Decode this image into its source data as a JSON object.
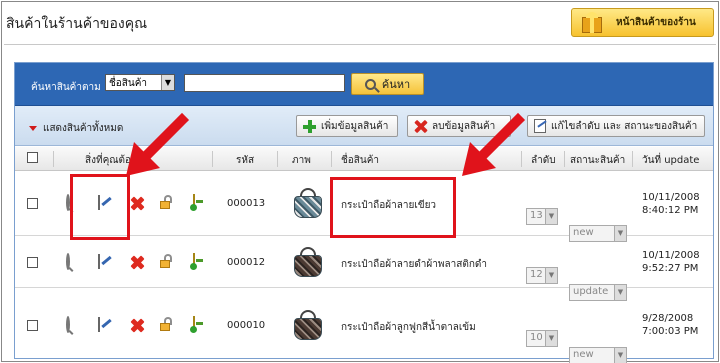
{
  "page": {
    "title": "สินค้าในร้านค้าของคุณ",
    "store_button_label": "หน้าสินค้าของร้าน"
  },
  "search": {
    "label": "ค้นหาสินค้าตาม :",
    "field_option": "ชื่อสินค้า",
    "query_value": "",
    "button_label": "ค้นหา"
  },
  "actions": {
    "show_all_label": "แสดงสินค้าทั้งหมด",
    "add_label": "เพิ่มข้อมูลสินค้า",
    "delete_label": "ลบข้อมูลสินค้า",
    "edit_order_label": "แก้ไขลำดับ และ สถานะของสินค้า"
  },
  "table": {
    "headers": {
      "actions": "สิ่งที่คุณต้องทำ",
      "code": "รหัส",
      "image": "ภาพ",
      "name": "ชื่อสินค้า",
      "order": "ลำดับ",
      "status": "สถานะสินค้า",
      "updated": "วันที่ update"
    },
    "rows": [
      {
        "code": "000013",
        "name": "กระเป๋าถือผ้าลายเขียว",
        "order": "13",
        "status": "new",
        "date": "10/11/2008",
        "time": "8:40:12 PM"
      },
      {
        "code": "000012",
        "name": "กระเป๋าถือผ้าลายดำผ้าพลาสติกดำ",
        "order": "12",
        "status": "update",
        "date": "10/11/2008",
        "time": "9:52:27 PM"
      },
      {
        "code": "000010",
        "name": "กระเป๋าถือผ้าลูกฟูกสีน้ำตาลเข้ม",
        "order": "10",
        "status": "new",
        "date": "9/28/2008",
        "time": "7:00:03 PM"
      }
    ]
  },
  "colors": {
    "search_bar": "#2d67b4",
    "annotation": "#e0131b",
    "button_gold": "#f5c23a"
  }
}
